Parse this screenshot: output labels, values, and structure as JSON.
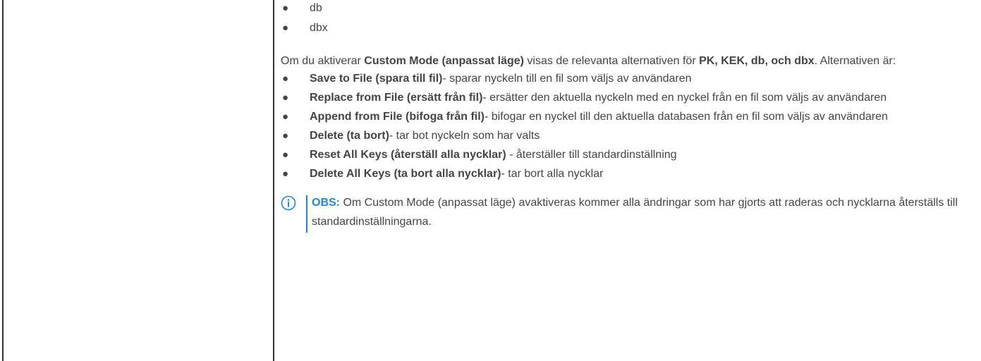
{
  "top_bullets": [
    "db",
    "dbx"
  ],
  "intro": {
    "t1": "Om du aktiverar ",
    "b1": "Custom Mode (anpassat läge)",
    "t2": " visas de relevanta alternativen för ",
    "b2": "PK, KEK, db, och dbx",
    "t3": ". Alternativen är:"
  },
  "options": [
    {
      "bold": "Save to File (spara till fil)",
      "text": "- sparar nyckeln till en fil som väljs av användaren"
    },
    {
      "bold": "Replace from File (ersätt från fil)",
      "text": "- ersätter den aktuella nyckeln med en nyckel från en fil som väljs av användaren"
    },
    {
      "bold": "Append from File (bifoga från fil)",
      "text": "- bifogar en nyckel till den aktuella databasen från en fil som väljs av användaren"
    },
    {
      "bold": "Delete (ta bort)",
      "text": "- tar bot nyckeln som har valts"
    },
    {
      "bold": "Reset All Keys (återställ alla nycklar)",
      "text": " - återställer till standardinställning"
    },
    {
      "bold": "Delete All Keys (ta bort alla nycklar)",
      "text": "- tar bort alla nycklar"
    }
  ],
  "note": {
    "label": "OBS:",
    "text": " Om Custom Mode (anpassat läge) avaktiveras kommer alla ändringar som har gjorts att raderas och nycklarna återställs till standardinställningarna."
  },
  "colors": {
    "text": "#444444",
    "accent": "#1e88d8",
    "border": "#333333"
  },
  "icons": {
    "bullet": "●",
    "note": "info-icon"
  }
}
